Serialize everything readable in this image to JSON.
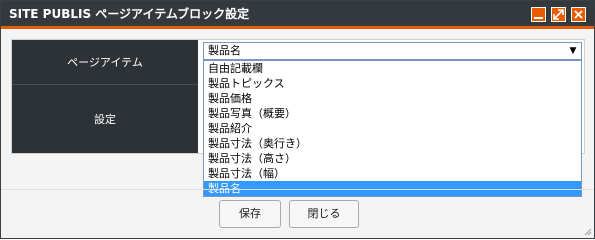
{
  "window": {
    "title": "SITE PUBLIS ページアイテムブロック設定",
    "accent": "#e65c00"
  },
  "form": {
    "rows": [
      {
        "label": "ページアイテム"
      },
      {
        "label": "設定"
      }
    ],
    "select": {
      "value": "製品名",
      "options": [
        "自由記載欄",
        "製品トピックス",
        "製品価格",
        "製品写真（概要）",
        "製品紹介",
        "製品寸法（奥行き）",
        "製品寸法（高さ）",
        "製品寸法（幅）",
        "製品名"
      ],
      "selected_index": 8
    }
  },
  "buttons": {
    "save": "保存",
    "close": "閉じる"
  },
  "icons": [
    "minimize-icon",
    "maximize-icon",
    "close-icon",
    "dropdown-arrow-icon",
    "resize-grip-icon"
  ]
}
